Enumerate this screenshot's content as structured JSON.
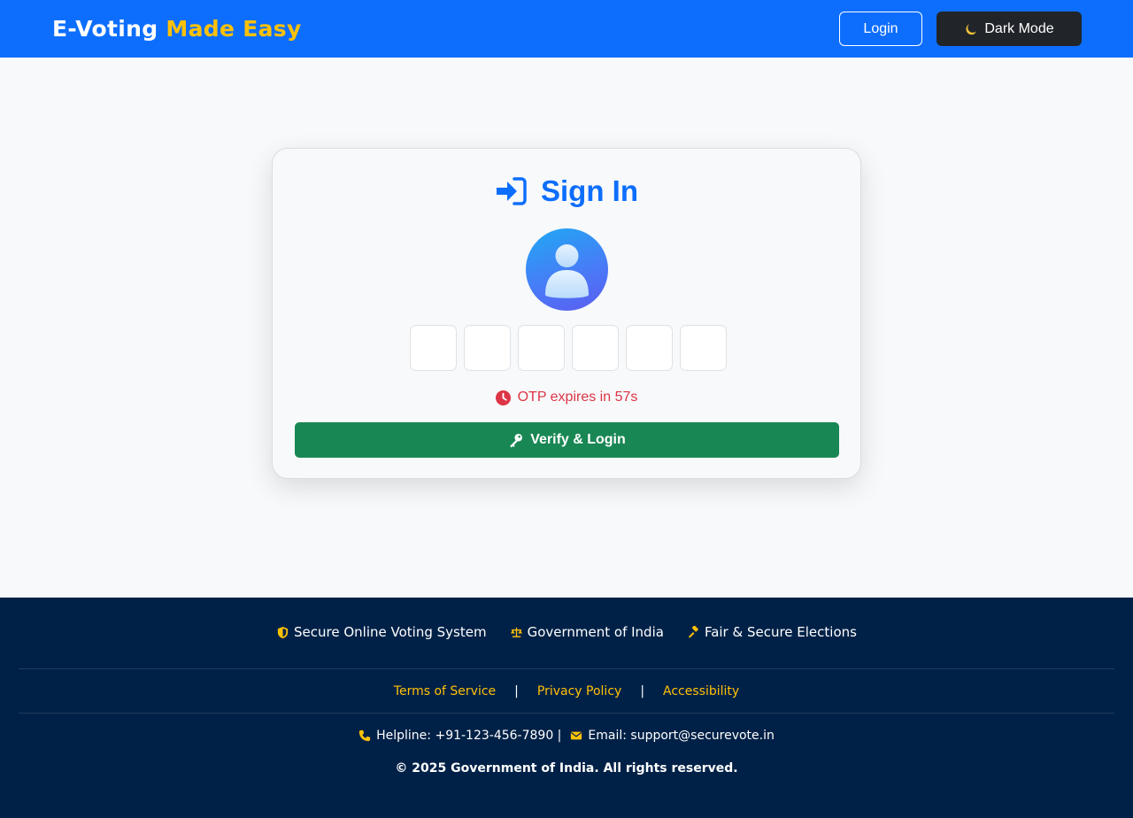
{
  "header": {
    "brand_main": "E-Voting",
    "brand_accent": "Made Easy",
    "login_label": "Login",
    "dark_mode_label": "Dark Mode"
  },
  "card": {
    "title": "Sign In",
    "otp_boxes": [
      "",
      "",
      "",
      "",
      "",
      ""
    ],
    "timer_text": "OTP expires in 57s",
    "verify_label": "Verify & Login"
  },
  "footer": {
    "features": [
      {
        "icon": "shield-icon",
        "label": "Secure Online Voting System"
      },
      {
        "icon": "scale-icon",
        "label": "Government of India"
      },
      {
        "icon": "gavel-icon",
        "label": "Fair & Secure Elections"
      }
    ],
    "links": [
      "Terms of Service",
      "Privacy Policy",
      "Accessibility"
    ],
    "separator": "|",
    "helpline": "Helpline: +91-123-456-7890 |",
    "email": "Email: support@securevote.in",
    "copyright": "© 2025 Government of India. All rights reserved."
  },
  "colors": {
    "primary": "#0d6efd",
    "accent": "#ffc107",
    "success": "#198754",
    "danger": "#dc3545",
    "footer_bg": "#002147"
  }
}
